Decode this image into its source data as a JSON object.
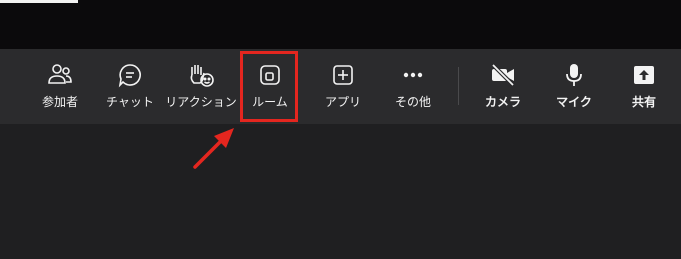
{
  "toolbar": {
    "participants_label": "参加者",
    "chat_label": "チャット",
    "reactions_label": "リアクション",
    "rooms_label": "ルーム",
    "apps_label": "アプリ",
    "more_label": "その他",
    "camera_label": "カメラ",
    "mic_label": "マイク",
    "share_label": "共有"
  },
  "icons": {
    "participants": "people-icon",
    "chat": "chat-bubble-icon",
    "reactions": "raised-hand-icon",
    "rooms": "rooms-icon",
    "apps": "plus-square-icon",
    "more": "ellipsis-icon",
    "camera": "camera-off-icon",
    "mic": "microphone-icon",
    "share": "share-up-icon"
  },
  "colors": {
    "background": "#1f1f21",
    "toolbar": "#2b2b2d",
    "topbar": "#0b0a0c",
    "highlight": "#e4261f",
    "text": "#f3f3f3"
  }
}
